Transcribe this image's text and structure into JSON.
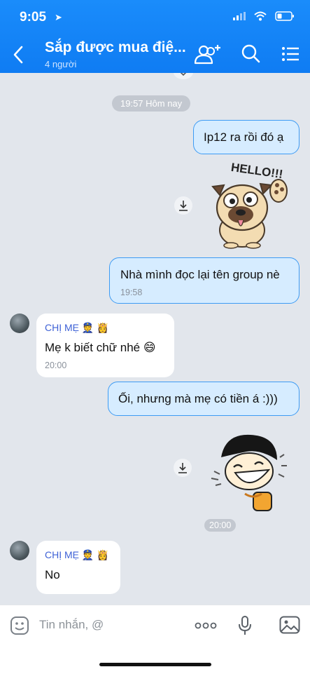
{
  "status": {
    "time": "9:05"
  },
  "header": {
    "title": "Sắp được mua điệ...",
    "subtitle": "4 người"
  },
  "chat": {
    "date_label": "19:57 Hôm nay",
    "msg1": {
      "text": "Ip12 ra rồi đó ạ"
    },
    "sticker1": {
      "text": "HELLO!!!"
    },
    "msg2": {
      "text": "Nhà mình đọc lại tên group nè",
      "time": "19:58"
    },
    "msg3": {
      "sender": "CHỊ MẸ 👮 👸",
      "text": "Mẹ k biết chữ nhé 😄",
      "time": "20:00"
    },
    "msg4": {
      "text": "Ối, nhưng mà mẹ có tiền á :)))"
    },
    "sticker2_time": "20:00",
    "msg5": {
      "sender": "CHỊ MẸ 👮 👸",
      "text": "No"
    }
  },
  "composer": {
    "placeholder": "Tin nhắn, @"
  },
  "colors": {
    "header": "#0f7cf3",
    "mine_bubble": "#d6ecff",
    "mine_border": "#3d9bf4",
    "sender": "#3f62d6"
  }
}
